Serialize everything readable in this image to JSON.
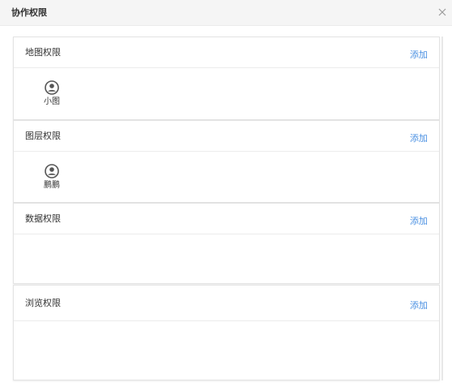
{
  "dialog": {
    "title": "协作权限",
    "close_icon": "close-icon"
  },
  "sections": [
    {
      "title": "地图权限",
      "add_label": "添加",
      "members": [
        {
          "name": "小图",
          "icon": "user-avatar-icon"
        }
      ]
    },
    {
      "title": "图层权限",
      "add_label": "添加",
      "members": [
        {
          "name": "鹏鹏",
          "icon": "user-avatar-icon"
        }
      ]
    },
    {
      "title": "数据权限",
      "add_label": "添加",
      "members": []
    },
    {
      "title": "浏览权限",
      "add_label": "添加",
      "members": []
    }
  ],
  "colors": {
    "link": "#4a90e2",
    "header_bg": "#f5f5f5",
    "avatar": "#555555"
  }
}
